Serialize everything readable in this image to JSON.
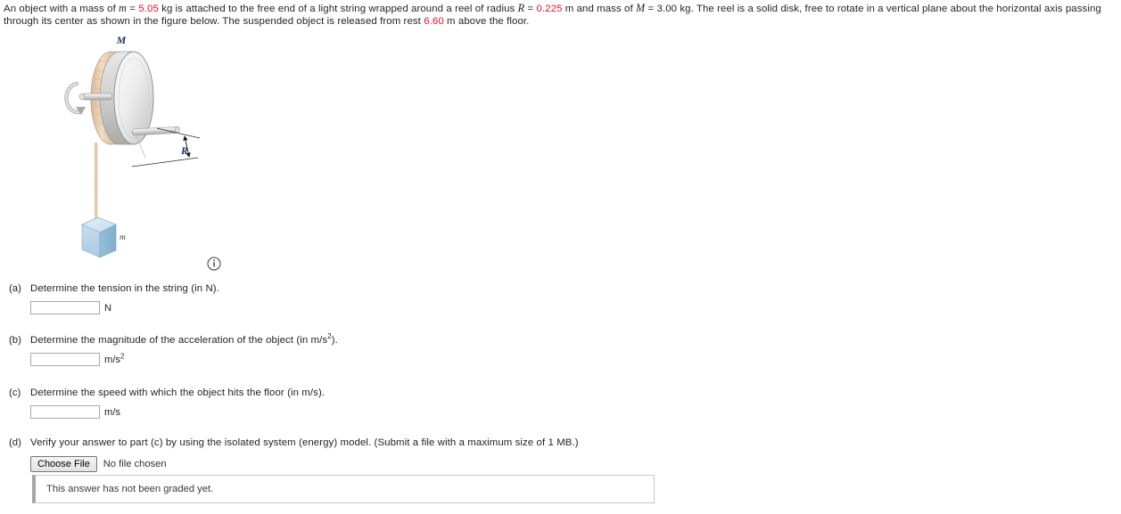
{
  "problem": {
    "line1_part1": "An object with a mass of ",
    "sym_m": "m",
    "eq1": " = ",
    "val_m": "5.05",
    "line1_part2": " kg is attached to the free end of a light string wrapped around a reel of radius ",
    "sym_R": "R",
    "eq2": " = ",
    "val_R": "0.225",
    "line1_part3": " m and mass of ",
    "sym_M": "M",
    "eq3": " = ",
    "val_M": "3.00",
    "line1_part4": " kg. The reel is a solid disk, free to rotate in a vertical plane about the horizontal axis",
    "line2_part1": "passing through its center as shown in the figure below. The suspended object is released from rest ",
    "val_h": "6.60",
    "line2_part2": " m above the floor."
  },
  "figure": {
    "label_M": "M",
    "label_R": "R",
    "label_m": "m",
    "info_icon": "i",
    "colors": {
      "disk_light": "#f2f2f2",
      "disk_mid": "#d4d4d4",
      "disk_edge": "#a8a8a8",
      "string": "#e6cdb4",
      "block_front": "#b8d3e5",
      "block_top": "#d6e7f2",
      "block_side": "#8fb9d4",
      "label_navy": "#1f2d5a"
    }
  },
  "parts": [
    {
      "label": "(a)",
      "question": "Determine the tension in the string (in N).",
      "input_value": "",
      "unit": "N",
      "unit_sup": ""
    },
    {
      "label": "(b)",
      "question_pre": "Determine the magnitude of the acceleration of the object (in m/s",
      "question_sup": "2",
      "question_post": ").",
      "input_value": "",
      "unit": "m/s",
      "unit_sup": "2"
    },
    {
      "label": "(c)",
      "question": "Determine the speed with which the object hits the floor (in m/s).",
      "input_value": "",
      "unit": "m/s",
      "unit_sup": ""
    },
    {
      "label": "(d)",
      "question": "Verify your answer to part (c) by using the isolated system (energy) model. (Submit a file with a maximum size of 1 MB.)",
      "choose_file_label": "Choose File",
      "file_status": "No file chosen"
    }
  ],
  "graded_note": "This answer has not been graded yet."
}
